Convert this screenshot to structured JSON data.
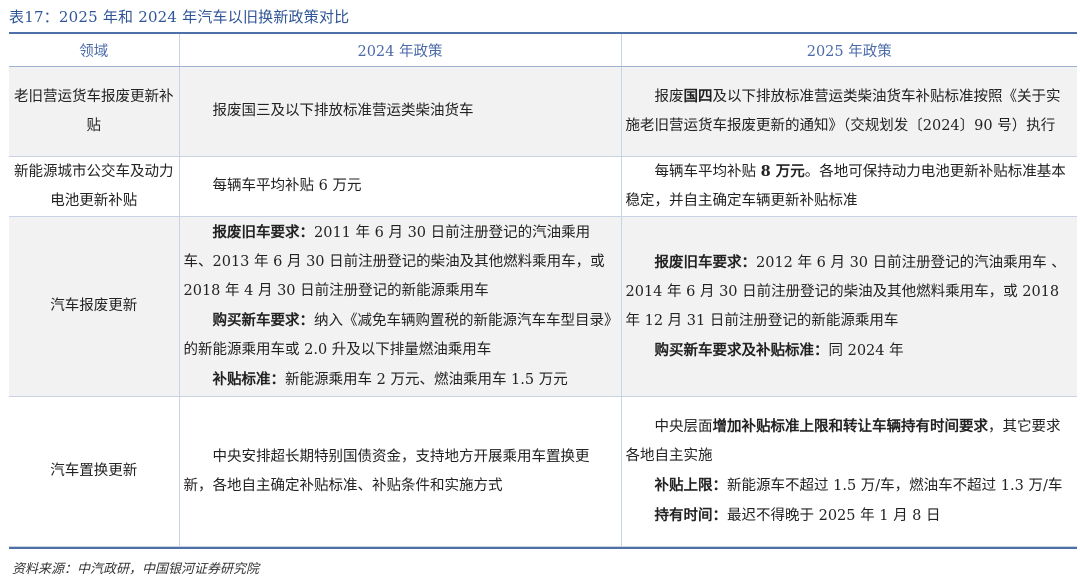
{
  "caption": "表17：2025 年和 2024 年汽车以旧换新政策对比",
  "headers": {
    "field": "领域",
    "y2024": "2024 年政策",
    "y2025": "2025 年政策"
  },
  "rows": [
    {
      "field": "老旧营运货车报废更新补贴",
      "p2024": "报废国三及以下排放标准营运类柴油货车",
      "p2025_pre": "报废",
      "p2025_bold": "国四",
      "p2025_post": "及以下排放标准营运类柴油货车补贴标准按照《关于实施老旧营运货车报废更新的通知》（交规划发〔2024〕90 号）执行"
    },
    {
      "field": "新能源城市公交车及动力电池更新补贴",
      "p2024": "每辆车平均补贴 6 万元",
      "p2025_pre": "每辆车平均补贴 ",
      "p2025_bold": "8 万元",
      "p2025_post": "。各地可保持动力电池更新补贴标准基本稳定，并自主确定车辆更新补贴标准"
    },
    {
      "field": "汽车报废更新",
      "p2024_a_label": "报废旧车要求：",
      "p2024_a_text": "2011 年 6 月 30 日前注册登记的汽油乘用车、2013 年 6 月 30 日前注册登记的柴油及其他燃料乘用车，或 2018 年 4 月 30 日前注册登记的新能源乘用车",
      "p2024_b_label": "购买新车要求：",
      "p2024_b_text": "纳入《减免车辆购置税的新能源汽车车型目录》的新能源乘用车或 2.0 升及以下排量燃油乘用车",
      "p2024_c_label": "补贴标准：",
      "p2024_c_text": "新能源乘用车 2 万元、燃油乘用车 1.5 万元",
      "p2025_a_label": "报废旧车要求：",
      "p2025_a_text": "2012 年 6 月 30 日前注册登记的汽油乘用车 、2014 年 6 月 30 日前注册登记的柴油及其他燃料乘用车，或 2018 年 12 月 31 日前注册登记的新能源乘用车",
      "p2025_b_label": "购买新车要求及补贴标准：",
      "p2025_b_text": "同 2024 年"
    },
    {
      "field": "汽车置换更新",
      "p2024": "中央安排超长期特别国债资金，支持地方开展乘用车置换更新，各地自主确定补贴标准、补贴条件和实施方式",
      "p2025_a_pre": "中央层面",
      "p2025_a_bold": "增加补贴标准上限和转让车辆持有时间要求",
      "p2025_a_post": "，其它要求各地自主实施",
      "p2025_b_label": "补贴上限：",
      "p2025_b_text": "新能源车不超过 1.5 万/车，燃油车不超过 1.3 万/车",
      "p2025_c_label": "持有时间：",
      "p2025_c_text": "最迟不得晚于 2025 年 1 月 8 日"
    }
  ],
  "source": "资料来源：中汽政研，中国银河证券研究院"
}
